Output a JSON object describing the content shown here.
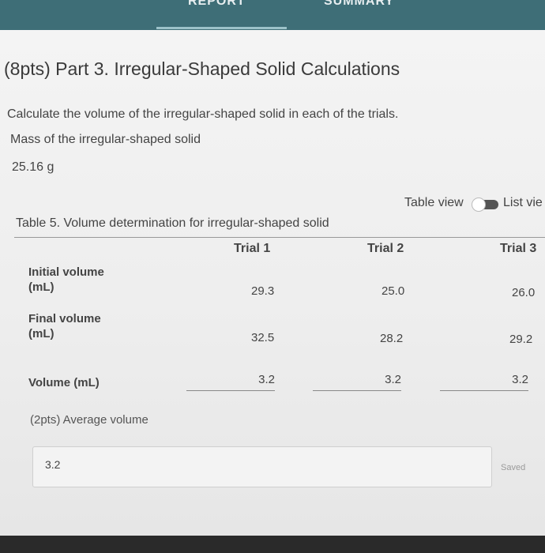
{
  "tabs": {
    "report": "REPORT",
    "summary": "SUMMARY"
  },
  "title": "(8pts) Part 3. Irregular-Shaped Solid Calculations",
  "instruction": "Calculate the volume of the irregular-shaped solid in each of the trials.",
  "mass": {
    "label": "Mass of the irregular-shaped solid",
    "value": "25.16 g"
  },
  "view": {
    "table": "Table view",
    "list": "List vie"
  },
  "table": {
    "caption": "Table 5. Volume determination for irregular-shaped solid",
    "columns": [
      "Trial 1",
      "Trial 2",
      "Trial 3"
    ],
    "rows": [
      {
        "label_1": "Initial volume",
        "label_2": "(mL)",
        "values": [
          "29.3",
          "25.0",
          "26.0"
        ]
      },
      {
        "label_1": "Final volume",
        "label_2": "(mL)",
        "values": [
          "32.5",
          "28.2",
          "29.2"
        ]
      },
      {
        "label_1": "Volume (mL)",
        "values": [
          "3.2",
          "3.2",
          "3.2"
        ]
      }
    ]
  },
  "average": {
    "label": "(2pts)  Average volume",
    "value": "3.2",
    "status": "Saved"
  }
}
